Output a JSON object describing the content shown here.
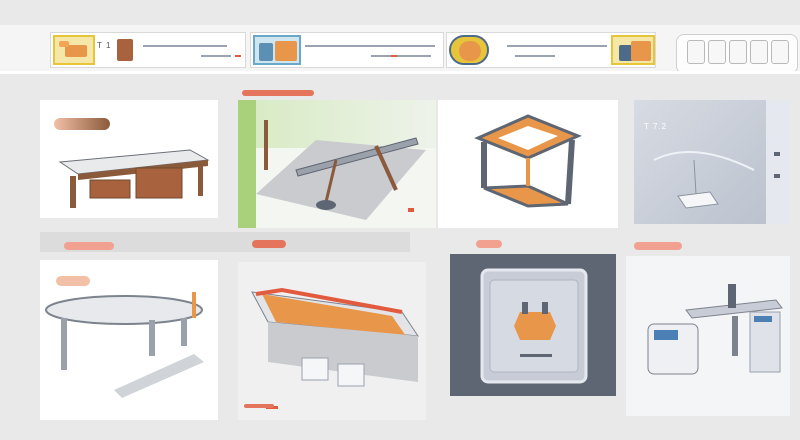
{
  "colors": {
    "accent_orange": "#e8964a",
    "accent_red": "#e25b3f",
    "green_panel": "#a9d07a",
    "slate": "#5f6673",
    "frame_blue": "#c7ccd6",
    "wood_brown": "#8a5a3a"
  },
  "tabs": [
    {
      "icon": "sofa-thumbnail-icon",
      "label": "T 1"
    },
    {
      "icon": "chair-thumbnail-icon",
      "label": ""
    },
    {
      "icon": "cabinet-thumbnail-icon",
      "label": ""
    }
  ],
  "window_buttons": [
    "square-icon",
    "square-icon",
    "square-icon",
    "square-icon",
    "square-icon"
  ],
  "cards": [
    {
      "name": "wooden-desk",
      "icon": "desk-illustration-icon"
    },
    {
      "name": "drafting-table",
      "icon": "drafting-table-icon"
    },
    {
      "name": "orange-frame-table",
      "icon": "frame-table-icon"
    },
    {
      "name": "server-panel",
      "icon": "panel-illustration-icon",
      "label": "T 7.2"
    },
    {
      "name": "long-bench",
      "icon": "bench-illustration-icon"
    },
    {
      "name": "red-trim-platform",
      "icon": "platform-illustration-icon"
    },
    {
      "name": "framed-tile",
      "icon": "tile-illustration-icon"
    },
    {
      "name": "appliance-desk",
      "icon": "appliance-illustration-icon"
    }
  ]
}
